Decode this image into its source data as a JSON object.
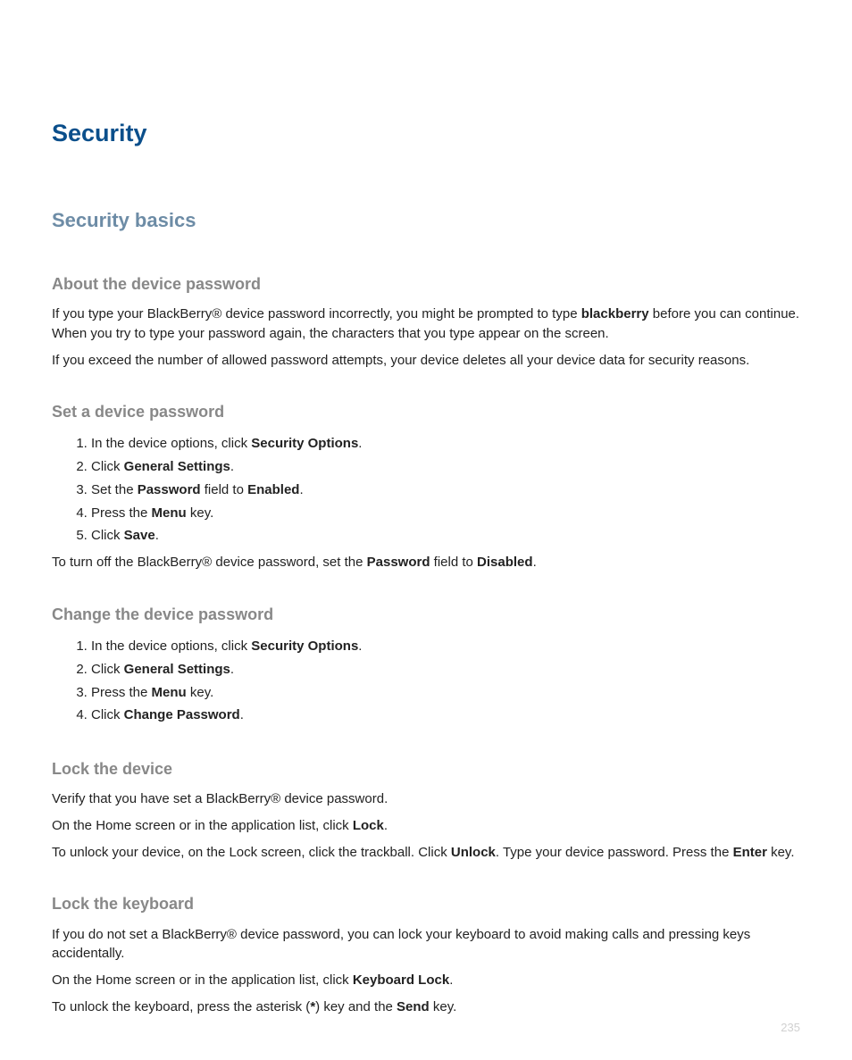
{
  "title": "Security",
  "section": "Security basics",
  "sub_about": {
    "title": "About the device password",
    "p1_a": "If you type your BlackBerry® device password incorrectly, you might be prompted to type ",
    "p1_b_bold": "blackberry",
    "p1_c": " before you can continue. When you try to type your password again, the characters that you type appear on the screen.",
    "p2": "If you exceed the number of allowed password attempts, your device deletes all your device data for security reasons."
  },
  "sub_set": {
    "title": "Set a device password",
    "s1_a": "In the device options, click ",
    "s1_b_bold": "Security Options",
    "s1_c": ".",
    "s2_a": "Click ",
    "s2_b_bold": "General Settings",
    "s2_c": ".",
    "s3_a": "Set the ",
    "s3_b_bold": "Password",
    "s3_c": " field to ",
    "s3_d_bold": "Enabled",
    "s3_e": ".",
    "s4_a": "Press the ",
    "s4_b_bold": "Menu",
    "s4_c": " key.",
    "s5_a": "Click ",
    "s5_b_bold": "Save",
    "s5_c": ".",
    "after_a": "To turn off the BlackBerry® device password, set the ",
    "after_b_bold": "Password",
    "after_c": " field to ",
    "after_d_bold": "Disabled",
    "after_e": "."
  },
  "sub_change": {
    "title": "Change the device password",
    "s1_a": "In the device options, click ",
    "s1_b_bold": "Security Options",
    "s1_c": ".",
    "s2_a": "Click ",
    "s2_b_bold": "General Settings",
    "s2_c": ".",
    "s3_a": "Press the ",
    "s3_b_bold": "Menu",
    "s3_c": " key.",
    "s4_a": "Click ",
    "s4_b_bold": "Change Password",
    "s4_c": "."
  },
  "sub_lockdev": {
    "title": "Lock the device",
    "p1": "Verify that you have set a BlackBerry® device password.",
    "p2_a": "On the Home screen or in the application list, click ",
    "p2_b_bold": "Lock",
    "p2_c": ".",
    "p3_a": "To unlock your device, on the Lock screen, click the trackball. Click ",
    "p3_b_bold": "Unlock",
    "p3_c": ". Type your device password. Press the ",
    "p3_d_bold": "Enter",
    "p3_e": " key."
  },
  "sub_lockkb": {
    "title": "Lock the keyboard",
    "p1": "If you do not set a BlackBerry® device password, you can lock your keyboard to avoid making calls and pressing keys accidentally.",
    "p2_a": "On the Home screen or in the application list, click ",
    "p2_b_bold": "Keyboard Lock",
    "p2_c": ".",
    "p3_a": "To unlock the keyboard, press the asterisk (",
    "p3_b_bold": "*",
    "p3_c": ") key and the ",
    "p3_d_bold": "Send",
    "p3_e": " key."
  },
  "page_number": "235"
}
